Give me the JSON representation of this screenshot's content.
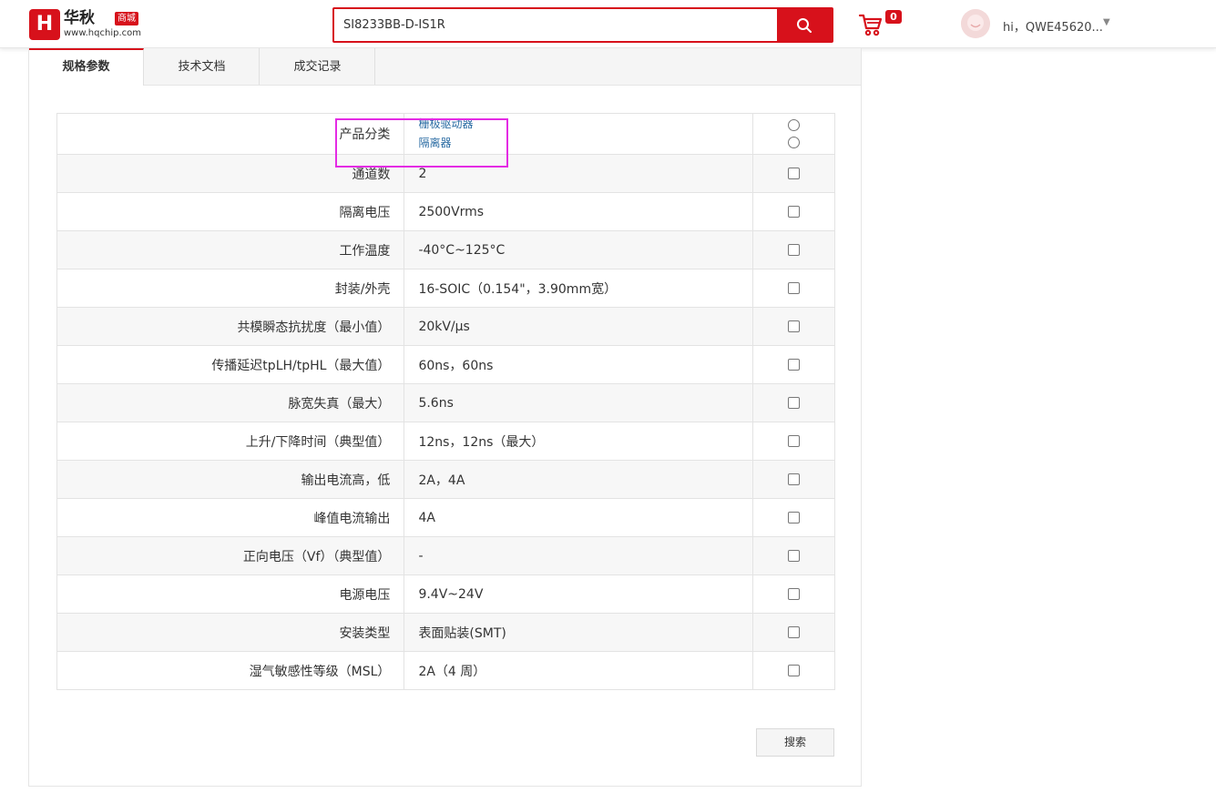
{
  "header": {
    "logo_mark": "H",
    "logo_name": "华秋",
    "logo_badge": "商城",
    "logo_url": "www.hqchip.com",
    "search_value": "SI8233BB-D-IS1R",
    "cart_count": "0",
    "user_name": "hi，QWE45620..."
  },
  "tabs": [
    "规格参数",
    "技术文档",
    "成交记录"
  ],
  "category": {
    "label": "产品分类",
    "options": [
      "栅极驱动器",
      "隔离器"
    ]
  },
  "specs": [
    {
      "key": "通道数",
      "value": "2"
    },
    {
      "key": "隔离电压",
      "value": "2500Vrms"
    },
    {
      "key": "工作温度",
      "value": "-40°C~125°C"
    },
    {
      "key": "封装/外壳",
      "value": "16-SOIC（0.154\"，3.90mm宽）"
    },
    {
      "key": "共模瞬态抗扰度（最小值）",
      "value": "20kV/µs"
    },
    {
      "key": "传播延迟tpLH/tpHL（最大值）",
      "value": "60ns，60ns"
    },
    {
      "key": "脉宽失真（最大）",
      "value": "5.6ns"
    },
    {
      "key": "上升/下降时间（典型值）",
      "value": "12ns，12ns（最大）"
    },
    {
      "key": "输出电流高，低",
      "value": "2A，4A"
    },
    {
      "key": "峰值电流输出",
      "value": "4A"
    },
    {
      "key": "正向电压（Vf）（典型值）",
      "value": "-"
    },
    {
      "key": "电源电压",
      "value": "9.4V~24V"
    },
    {
      "key": "安装类型",
      "value": "表面贴装(SMT)"
    },
    {
      "key": "湿气敏感性等级（MSL）",
      "value": "2A（4 周）"
    }
  ],
  "search_button": "搜索",
  "colors": {
    "brand": "#d7111b",
    "highlight": "#e42be4",
    "link": "#2b6ca3"
  }
}
